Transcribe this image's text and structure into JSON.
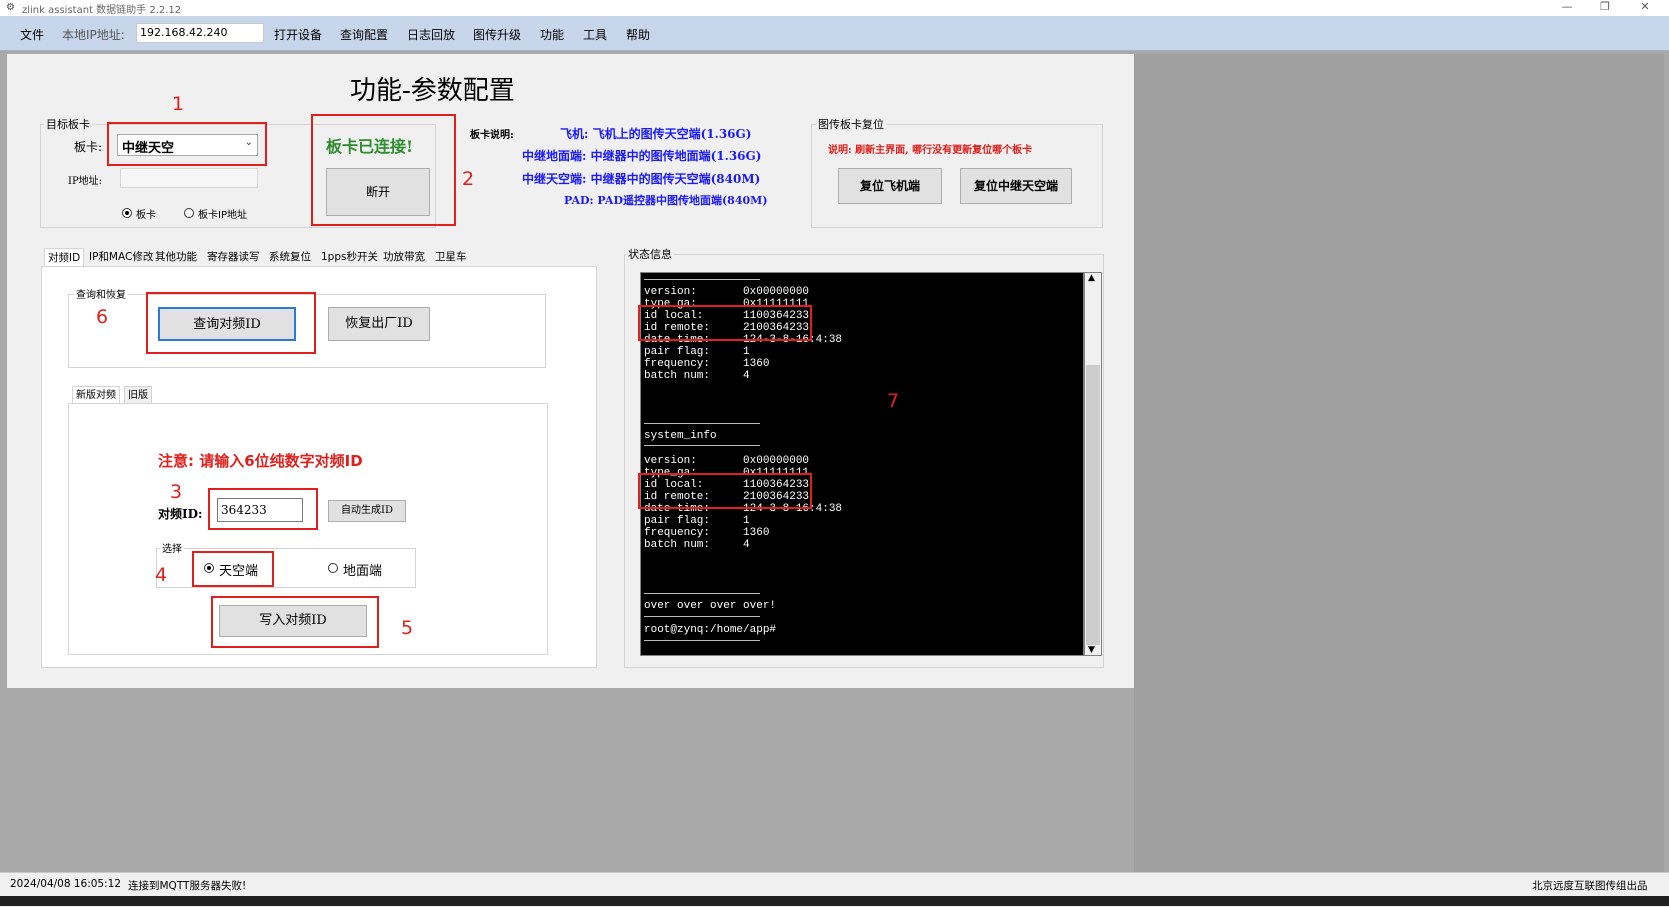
{
  "window": {
    "title": "zlink assistant 数据链助手 2.2.12",
    "minimize": "—",
    "restore": "❐",
    "close": "✕"
  },
  "menubar": {
    "file": "文件",
    "local_ip_label": "本地IP地址:",
    "local_ip_value": "192.168.42.240",
    "items": [
      "打开设备",
      "查询配置",
      "日志回放",
      "图传升级",
      "功能",
      "工具",
      "帮助"
    ]
  },
  "page_title": "功能-参数配置",
  "target_board": {
    "group_label": "目标板卡",
    "board_label": "板卡:",
    "board_value": "中继天空",
    "ip_label": "IP地址:",
    "radio_board": "板卡",
    "radio_board_ip": "板卡IP地址"
  },
  "connection": {
    "status": "板卡已连接!",
    "disconnect": "断开"
  },
  "board_desc": {
    "title": "板卡说明:",
    "lines": [
      "飞机: 飞机上的图传天空端(1.36G)",
      "中继地面端: 中继器中的图传地面端(1.36G)",
      "中继天空端: 中继器中的图传天空端(840M)",
      "PAD: PAD遥控器中图传地面端(840M)"
    ]
  },
  "reset": {
    "group_label": "图传板卡复位",
    "note": "说明: 刷新主界面, 哪行没有更新复位哪个板卡",
    "reset_aircraft": "复位飞机端",
    "reset_relay_sky": "复位中继天空端"
  },
  "tabs": [
    "对频ID",
    "IP和MAC修改",
    "其他功能",
    "寄存器读写",
    "系统复位",
    "1pps秒开关",
    "功放带宽",
    "卫星车"
  ],
  "query_restore": {
    "group_label": "查询和恢复",
    "query_btn": "查询对频ID",
    "restore_btn": "恢复出厂ID"
  },
  "sub_tabs": [
    "新版对频",
    "旧版"
  ],
  "pairing": {
    "notice": "注意: 请输入6位纯数字对频ID",
    "id_label": "对频ID:",
    "id_value": "364233",
    "auto_gen": "自动生成ID",
    "select_label": "选择",
    "radio_sky": "天空端",
    "radio_ground": "地面端",
    "write_btn": "写入对频ID"
  },
  "annotations": [
    "1",
    "2",
    "3",
    "4",
    "5",
    "6",
    "7"
  ],
  "status_info": {
    "label": "状态信息",
    "block1": [
      "version:       0x00000000",
      "type_ga:       0x11111111",
      "id local:      1100364233",
      "id remote:     2100364233",
      "date time:     124-3-8-16:4:38",
      "pair flag:     1",
      "frequency:     1360",
      "batch num:     4"
    ],
    "section": "system_info",
    "block2": [
      "version:       0x00000000",
      "type_ga:       0x11111111",
      "id local:      1100364233",
      "id remote:     2100364233",
      "date time:     124-3-8-16:4:38",
      "pair flag:     1",
      "frequency:     1360",
      "batch num:     4"
    ],
    "over": "over over over over!",
    "prompt": "root@zynq:/home/app#"
  },
  "statusbar": {
    "datetime": "2024/04/08 16:05:12",
    "message": "连接到MQTT服务器失败!",
    "right": "北京远度互联图传组出品"
  },
  "colors": {
    "accent_red": "#e0201c",
    "link_blue": "#1a1aff",
    "connected_green": "#2e8b2e",
    "menubar": "#c8d6ec"
  }
}
